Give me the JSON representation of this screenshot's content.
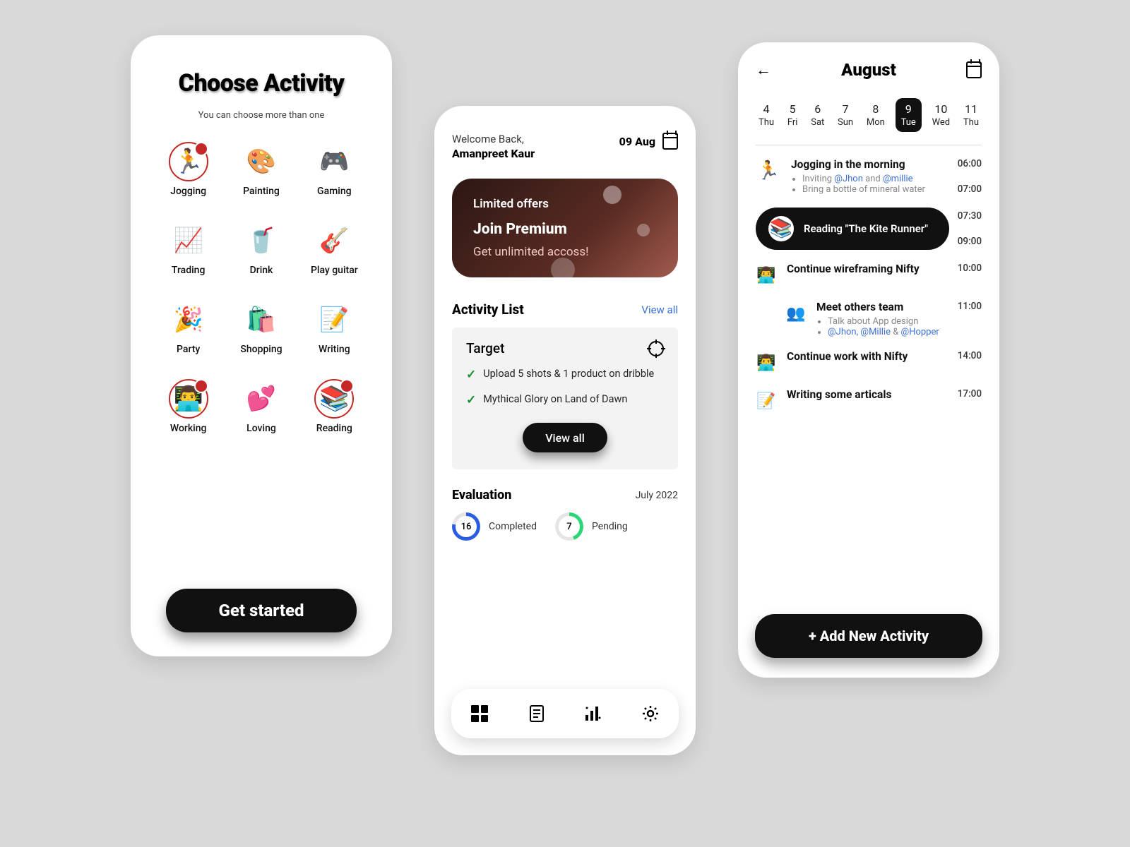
{
  "screen1": {
    "title": "Choose Activity",
    "subtitle": "You can choose more than one",
    "activities": [
      {
        "label": "Jogging",
        "emoji": "🏃",
        "selected": true
      },
      {
        "label": "Painting",
        "emoji": "🎨",
        "selected": false
      },
      {
        "label": "Gaming",
        "emoji": "🎮",
        "selected": false
      },
      {
        "label": "Trading",
        "emoji": "📈",
        "selected": false
      },
      {
        "label": "Drink",
        "emoji": "🥤",
        "selected": false
      },
      {
        "label": "Play guitar",
        "emoji": "🎸",
        "selected": false
      },
      {
        "label": "Party",
        "emoji": "🎉",
        "selected": false
      },
      {
        "label": "Shopping",
        "emoji": "🛍️",
        "selected": false
      },
      {
        "label": "Writing",
        "emoji": "📝",
        "selected": false
      },
      {
        "label": "Working",
        "emoji": "👨‍💻",
        "selected": true
      },
      {
        "label": "Loving",
        "emoji": "💕",
        "selected": false
      },
      {
        "label": "Reading",
        "emoji": "📚",
        "selected": true
      }
    ],
    "cta": "Get started"
  },
  "screen2": {
    "welcome_small": "Welcome Back,",
    "welcome_name": "Amanpreet Kaur",
    "date": "09 Aug",
    "promo": {
      "line1": "Limited offers",
      "line2": "Join Premium",
      "line3": "Get unlimited accoss!"
    },
    "activity_list_title": "Activity List",
    "view_all": "View all",
    "target": {
      "title": "Target",
      "items": [
        "Upload 5 shots & 1 product on dribble",
        "Mythical Glory on Land of Dawn"
      ],
      "btn": "View all"
    },
    "evaluation": {
      "title": "Evaluation",
      "month": "July 2022",
      "completed_count": "16",
      "completed_label": "Completed",
      "pending_count": "7",
      "pending_label": "Pending"
    }
  },
  "screen3": {
    "month": "August",
    "days": [
      {
        "num": "4",
        "name": "Thu"
      },
      {
        "num": "5",
        "name": "Fri"
      },
      {
        "num": "6",
        "name": "Sat"
      },
      {
        "num": "7",
        "name": "Sun"
      },
      {
        "num": "8",
        "name": "Mon"
      },
      {
        "num": "9",
        "name": "Tue"
      },
      {
        "num": "10",
        "name": "Wed"
      },
      {
        "num": "11",
        "name": "Thu"
      }
    ],
    "selected_day_index": 5,
    "agenda": {
      "jogging": {
        "title": "Jogging in the morning",
        "sub1_pre": "Inviting ",
        "sub1_m1": "@Jhon",
        "sub1_mid": " and ",
        "sub1_m2": "@millie",
        "sub2": "Bring a bottle of mineral water",
        "t1": "06:00",
        "t2": "07:00"
      },
      "reading": {
        "title": "Reading \"The Kite Runner\"",
        "t1": "07:30",
        "t2": "09:00"
      },
      "wireframe": {
        "title": "Continue wireframing Nifty",
        "t": "10:00"
      },
      "meet": {
        "title": "Meet others team",
        "sub1": "Talk about App design",
        "m1": "@Jhon,",
        "m2": "@Millie",
        "amp": " & ",
        "m3": "@Hopper",
        "t": "11:00"
      },
      "work": {
        "title": "Continue work with Nifty",
        "t": "14:00"
      },
      "writing": {
        "title": "Writing some articals",
        "t": "17:00"
      }
    },
    "cta": "+ Add New Activity"
  }
}
